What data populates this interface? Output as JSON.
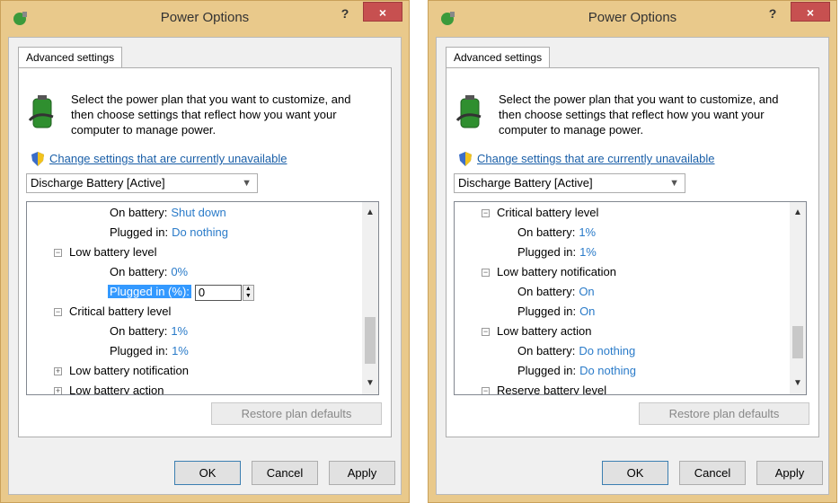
{
  "windows": [
    {
      "title": "Power Options",
      "help_label": "?",
      "close_label": "×",
      "tab_label": "Advanced settings",
      "description": "Select the power plan that you want to customize, and then choose settings that reflect how you want your computer to manage power.",
      "change_settings_link": "Change settings that are currently unavailable",
      "plan_selected": "Discharge Battery [Active]",
      "tree_rows": [
        {
          "label": "On battery:",
          "value": "Shut down"
        },
        {
          "label": "Plugged in:",
          "value": "Do nothing"
        },
        {
          "label": "Low battery level",
          "expander": "−"
        },
        {
          "label": "On battery:",
          "value": "0%"
        },
        {
          "label": "Plugged in (%):",
          "input_value": "0"
        },
        {
          "label": "Critical battery level",
          "expander": "−"
        },
        {
          "label": "On battery:",
          "value": "1%"
        },
        {
          "label": "Plugged in:",
          "value": "1%"
        },
        {
          "label": "Low battery notification",
          "expander": "+"
        },
        {
          "label": "Low battery action",
          "expander": "+"
        }
      ],
      "scrollbar_position": 0.55,
      "restore_label": "Restore plan defaults",
      "buttons": {
        "ok": "OK",
        "cancel": "Cancel",
        "apply": "Apply"
      }
    },
    {
      "title": "Power Options",
      "help_label": "?",
      "close_label": "×",
      "tab_label": "Advanced settings",
      "description": "Select the power plan that you want to customize, and then choose settings that reflect how you want your computer to manage power.",
      "change_settings_link": "Change settings that are currently unavailable",
      "plan_selected": "Discharge Battery [Active]",
      "tree_rows": [
        {
          "label": "Critical battery level",
          "expander": "−"
        },
        {
          "label": "On battery:",
          "value": "1%"
        },
        {
          "label": "Plugged in:",
          "value": "1%"
        },
        {
          "label": "Low battery notification",
          "expander": "−"
        },
        {
          "label": "On battery:",
          "value": "On"
        },
        {
          "label": "Plugged in:",
          "value": "On"
        },
        {
          "label": "Low battery action",
          "expander": "−"
        },
        {
          "label": "On battery:",
          "value": "Do nothing"
        },
        {
          "label": "Plugged in:",
          "value": "Do nothing"
        },
        {
          "label": "Reserve battery level",
          "expander": "−"
        }
      ],
      "scrollbar_position": 0.7,
      "restore_label": "Restore plan defaults",
      "buttons": {
        "ok": "OK",
        "cancel": "Cancel",
        "apply": "Apply"
      }
    }
  ]
}
